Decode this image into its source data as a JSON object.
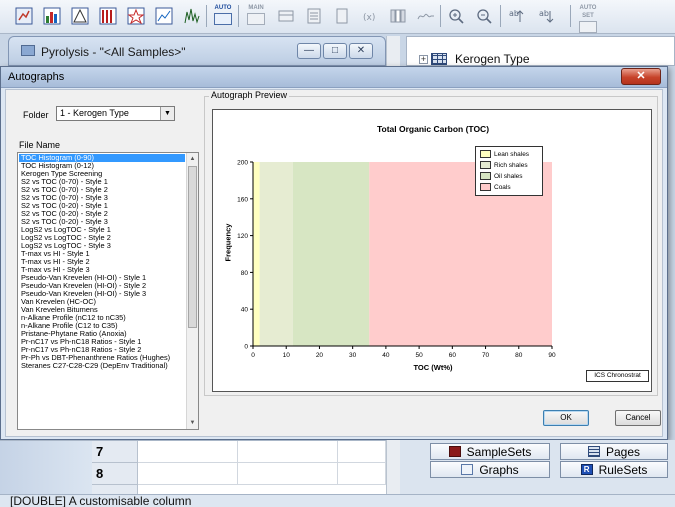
{
  "toolbar": {
    "auto_label": "AUTO",
    "main_label": "MAIN",
    "auto_set_label": "AUTO SET"
  },
  "bg_window": {
    "title": "Pyrolysis - \"<All Samples>\"",
    "min_glyph": "—",
    "max_glyph": "□",
    "close_glyph": "✕"
  },
  "tree": {
    "expand_glyph": "+",
    "item_label": "Kerogen Type"
  },
  "grid": {
    "rows": [
      "7",
      "8"
    ]
  },
  "panel_buttons": {
    "samplesets": "SampleSets",
    "pages": "Pages",
    "graphs": "Graphs",
    "rulesets": "RuleSets"
  },
  "status_bar": "[DOUBLE] A customisable column",
  "dialog": {
    "title": "Autographs",
    "close_glyph": "✕",
    "folder_label": "Folder",
    "folder_value": "1 - Kerogen Type",
    "file_name_label": "File Name",
    "preview_label": "Autograph Preview",
    "ok_label": "OK",
    "cancel_label": "Cancel",
    "files": [
      "TOC Histogram (0-90)",
      "TOC Histogram (0-12)",
      "Kerogen Type Screening",
      "S2 vs TOC (0-70) - Style 1",
      "S2 vs TOC (0-70) - Style 2",
      "S2 vs TOC (0-70) - Style 3",
      "S2 vs TOC (0-20) - Style 1",
      "S2 vs TOC (0-20) - Style 2",
      "S2 vs TOC (0-20) - Style 3",
      "LogS2 vs LogTOC - Style 1",
      "LogS2 vs LogTOC - Style 2",
      "LogS2 vs LogTOC - Style 3",
      "T-max vs HI - Style 1",
      "T-max vs HI - Style 2",
      "T-max vs HI - Style 3",
      "Pseudo-Van Krevelen (HI-OI) - Style 1",
      "Pseudo-Van Krevelen (HI-OI) - Style 2",
      "Pseudo-Van Krevelen (HI-OI) - Style 3",
      "Van Krevelen (HC-OC)",
      "Van Krevelen Bitumens",
      "n-Alkane Profile (nC12 to nC35)",
      "n-Alkane Profile (C12 to C35)",
      "Pristane-Phytane Ratio (Anoxia)",
      "Pr-nC17 vs Ph-nC18 Ratios - Style 1",
      "Pr-nC17 vs Ph-nC18 Ratios - Style 2",
      "Pr-Ph vs DBT-Phenanthrene Ratios (Hughes)",
      "Steranes C27-C28-C29 (DepEnv Traditional)"
    ],
    "selected_index": 0
  },
  "chart_data": {
    "type": "bar",
    "title": "Total Organic Carbon (TOC)",
    "xlabel": "TOC (Wt%)",
    "ylabel": "Frequency",
    "xlim": [
      0,
      90
    ],
    "ylim": [
      0,
      200
    ],
    "x_ticks": [
      "0",
      "10",
      "20",
      "30",
      "40",
      "50",
      "60",
      "70",
      "80",
      "90"
    ],
    "y_ticks": [
      "0",
      "40",
      "80",
      "120",
      "160",
      "200"
    ],
    "regions": [
      {
        "name": "Lean shales",
        "from": 0,
        "to": 2,
        "color": "#ffffc0"
      },
      {
        "name": "Rich shales",
        "from": 2,
        "to": 12,
        "color": "#e6ecd2"
      },
      {
        "name": "Oil shales",
        "from": 12,
        "to": 35,
        "color": "#d7e6c3"
      },
      {
        "name": "Coals",
        "from": 35,
        "to": 90,
        "color": "#ffcccc"
      }
    ],
    "legend_position": "top-right",
    "series": [],
    "watermark": "ICS Chronostrat"
  }
}
